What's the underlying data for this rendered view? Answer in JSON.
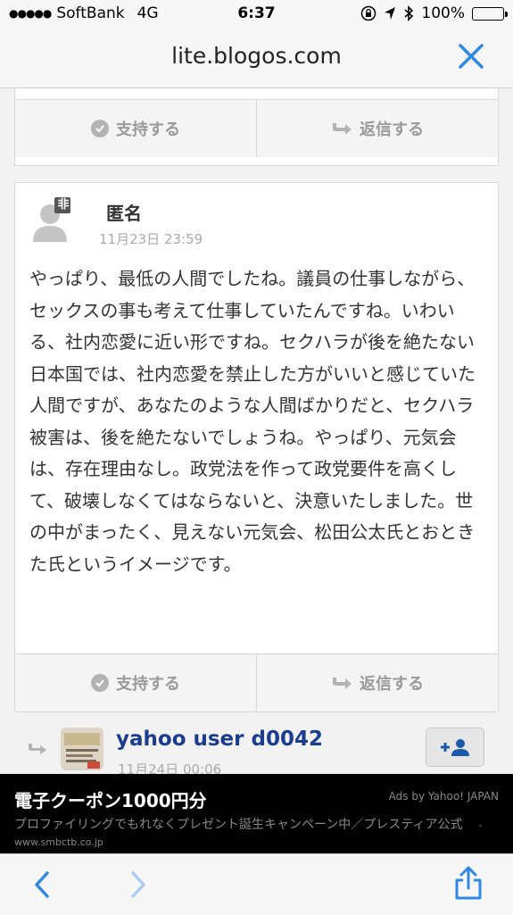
{
  "status_bar": {
    "carrier": "SoftBank",
    "network": "4G",
    "time": "6:37",
    "battery": "100%"
  },
  "browser": {
    "url": "lite.blogos.com"
  },
  "previous_comment": {
    "support_label": "支持する",
    "reply_label": "返信する"
  },
  "comment": {
    "author": "匿名",
    "badge": "非",
    "date": "11月23日 23:59",
    "text": "やっぱり、最低の人間でしたね。議員の仕事しながら、セックスの事も考えて仕事していたんですね。いわいる、社内恋愛に近い形ですね。セクハラが後を絶たない日本国では、社内恋愛を禁止した方がいいと感じていた人間ですが、あなたのような人間ばかりだと、セクハラ被害は、後を絶たないでしょうね。やっぱり、元気会は、存在理由なし。政党法を作って政党要件を高くして、破壊しなくてはならないと、決意いたしました。世の中がまったく、見えない元気会、松田公太氏とおときた氏というイメージです。",
    "support_label": "支持する",
    "reply_label": "返信する"
  },
  "next_comment": {
    "author": "yahoo user d0042",
    "date": "11月24日 00:06"
  },
  "ad": {
    "title": "電子クーポン1000円分",
    "attribution": "Ads by Yahoo! JAPAN",
    "description": "プロファイリングでもれなくプレゼント誕生キャンペーン中／プレスティア公式",
    "source": "- www.smbctb.co.jp"
  },
  "colors": {
    "link": "#1a3d8f",
    "ios_blue": "#2f88e6",
    "battery": "#4cd964"
  }
}
